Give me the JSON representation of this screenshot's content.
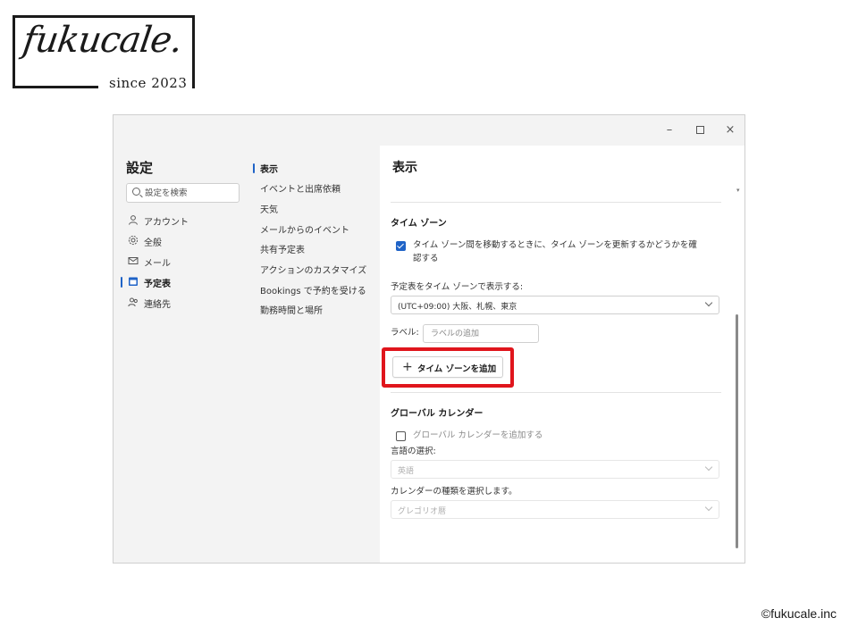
{
  "logo": {
    "script_text": "fukucale.",
    "since_text": "since 2023"
  },
  "copyright": "©fukucale.inc",
  "window": {
    "controls": {
      "minimize": "–",
      "close": "×"
    }
  },
  "settings": {
    "title": "設定",
    "search": {
      "placeholder": "設定を検索",
      "value": ""
    },
    "nav": [
      {
        "label": "アカウント",
        "icon": "person-icon"
      },
      {
        "label": "全般",
        "icon": "gear-icon"
      },
      {
        "label": "メール",
        "icon": "mail-icon"
      },
      {
        "label": "予定表",
        "icon": "calendar-icon",
        "active": true
      },
      {
        "label": "連絡先",
        "icon": "people-icon"
      }
    ],
    "subnav": [
      {
        "label": "表示",
        "active": true
      },
      {
        "label": "イベントと出席依頼"
      },
      {
        "label": "天気"
      },
      {
        "label": "メールからのイベント"
      },
      {
        "label": "共有予定表"
      },
      {
        "label": "アクションのカスタマイズ"
      },
      {
        "label": "Bookings で予約を受ける"
      },
      {
        "label": "勤務時間と場所"
      }
    ]
  },
  "display": {
    "heading": "表示",
    "timezone": {
      "title": "タイム ゾーン",
      "update_checkbox_line1": "タイム ゾーン間を移動するときに、タイム ゾーンを更新するかどうかを確",
      "update_checkbox_line2": "認する",
      "update_checked": true,
      "show_label": "予定表をタイム ゾーンで表示する:",
      "selected": "(UTC+09:00) 大阪、札幌、東京",
      "label_caption": "ラベル:",
      "label_placeholder": "ラベルの追加",
      "add_button": "タイム ゾーンを追加",
      "add_button_plus": "+"
    },
    "global_calendar": {
      "title": "グローバル カレンダー",
      "add_checkbox": "グローバル カレンダーを追加する",
      "add_checked": false,
      "language_label": "言語の選択:",
      "language_value": "英語",
      "type_label": "カレンダーの種類を選択します。",
      "type_value": "グレゴリオ暦"
    }
  },
  "colors": {
    "accent": "#1f63c7",
    "highlight": "#e0151c"
  }
}
